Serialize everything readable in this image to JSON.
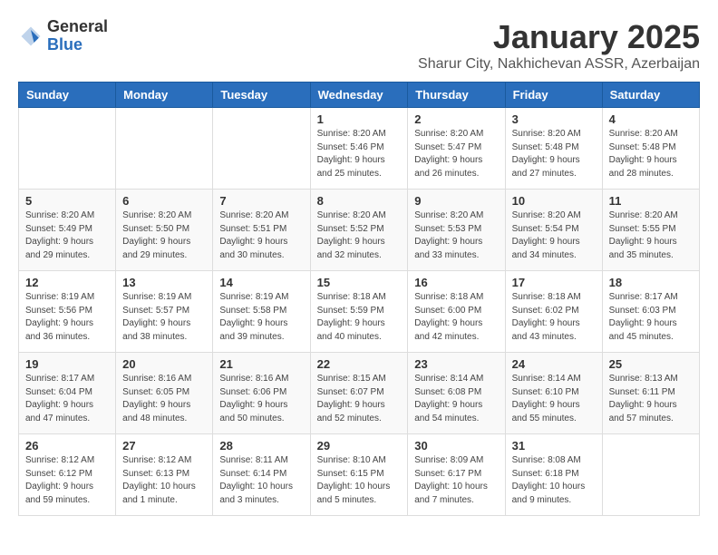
{
  "logo": {
    "general": "General",
    "blue": "Blue"
  },
  "title": "January 2025",
  "location": "Sharur City, Nakhichevan ASSR, Azerbaijan",
  "weekdays": [
    "Sunday",
    "Monday",
    "Tuesday",
    "Wednesday",
    "Thursday",
    "Friday",
    "Saturday"
  ],
  "weeks": [
    [
      {
        "day": "",
        "info": ""
      },
      {
        "day": "",
        "info": ""
      },
      {
        "day": "",
        "info": ""
      },
      {
        "day": "1",
        "info": "Sunrise: 8:20 AM\nSunset: 5:46 PM\nDaylight: 9 hours\nand 25 minutes."
      },
      {
        "day": "2",
        "info": "Sunrise: 8:20 AM\nSunset: 5:47 PM\nDaylight: 9 hours\nand 26 minutes."
      },
      {
        "day": "3",
        "info": "Sunrise: 8:20 AM\nSunset: 5:48 PM\nDaylight: 9 hours\nand 27 minutes."
      },
      {
        "day": "4",
        "info": "Sunrise: 8:20 AM\nSunset: 5:48 PM\nDaylight: 9 hours\nand 28 minutes."
      }
    ],
    [
      {
        "day": "5",
        "info": "Sunrise: 8:20 AM\nSunset: 5:49 PM\nDaylight: 9 hours\nand 29 minutes."
      },
      {
        "day": "6",
        "info": "Sunrise: 8:20 AM\nSunset: 5:50 PM\nDaylight: 9 hours\nand 29 minutes."
      },
      {
        "day": "7",
        "info": "Sunrise: 8:20 AM\nSunset: 5:51 PM\nDaylight: 9 hours\nand 30 minutes."
      },
      {
        "day": "8",
        "info": "Sunrise: 8:20 AM\nSunset: 5:52 PM\nDaylight: 9 hours\nand 32 minutes."
      },
      {
        "day": "9",
        "info": "Sunrise: 8:20 AM\nSunset: 5:53 PM\nDaylight: 9 hours\nand 33 minutes."
      },
      {
        "day": "10",
        "info": "Sunrise: 8:20 AM\nSunset: 5:54 PM\nDaylight: 9 hours\nand 34 minutes."
      },
      {
        "day": "11",
        "info": "Sunrise: 8:20 AM\nSunset: 5:55 PM\nDaylight: 9 hours\nand 35 minutes."
      }
    ],
    [
      {
        "day": "12",
        "info": "Sunrise: 8:19 AM\nSunset: 5:56 PM\nDaylight: 9 hours\nand 36 minutes."
      },
      {
        "day": "13",
        "info": "Sunrise: 8:19 AM\nSunset: 5:57 PM\nDaylight: 9 hours\nand 38 minutes."
      },
      {
        "day": "14",
        "info": "Sunrise: 8:19 AM\nSunset: 5:58 PM\nDaylight: 9 hours\nand 39 minutes."
      },
      {
        "day": "15",
        "info": "Sunrise: 8:18 AM\nSunset: 5:59 PM\nDaylight: 9 hours\nand 40 minutes."
      },
      {
        "day": "16",
        "info": "Sunrise: 8:18 AM\nSunset: 6:00 PM\nDaylight: 9 hours\nand 42 minutes."
      },
      {
        "day": "17",
        "info": "Sunrise: 8:18 AM\nSunset: 6:02 PM\nDaylight: 9 hours\nand 43 minutes."
      },
      {
        "day": "18",
        "info": "Sunrise: 8:17 AM\nSunset: 6:03 PM\nDaylight: 9 hours\nand 45 minutes."
      }
    ],
    [
      {
        "day": "19",
        "info": "Sunrise: 8:17 AM\nSunset: 6:04 PM\nDaylight: 9 hours\nand 47 minutes."
      },
      {
        "day": "20",
        "info": "Sunrise: 8:16 AM\nSunset: 6:05 PM\nDaylight: 9 hours\nand 48 minutes."
      },
      {
        "day": "21",
        "info": "Sunrise: 8:16 AM\nSunset: 6:06 PM\nDaylight: 9 hours\nand 50 minutes."
      },
      {
        "day": "22",
        "info": "Sunrise: 8:15 AM\nSunset: 6:07 PM\nDaylight: 9 hours\nand 52 minutes."
      },
      {
        "day": "23",
        "info": "Sunrise: 8:14 AM\nSunset: 6:08 PM\nDaylight: 9 hours\nand 54 minutes."
      },
      {
        "day": "24",
        "info": "Sunrise: 8:14 AM\nSunset: 6:10 PM\nDaylight: 9 hours\nand 55 minutes."
      },
      {
        "day": "25",
        "info": "Sunrise: 8:13 AM\nSunset: 6:11 PM\nDaylight: 9 hours\nand 57 minutes."
      }
    ],
    [
      {
        "day": "26",
        "info": "Sunrise: 8:12 AM\nSunset: 6:12 PM\nDaylight: 9 hours\nand 59 minutes."
      },
      {
        "day": "27",
        "info": "Sunrise: 8:12 AM\nSunset: 6:13 PM\nDaylight: 10 hours\nand 1 minute."
      },
      {
        "day": "28",
        "info": "Sunrise: 8:11 AM\nSunset: 6:14 PM\nDaylight: 10 hours\nand 3 minutes."
      },
      {
        "day": "29",
        "info": "Sunrise: 8:10 AM\nSunset: 6:15 PM\nDaylight: 10 hours\nand 5 minutes."
      },
      {
        "day": "30",
        "info": "Sunrise: 8:09 AM\nSunset: 6:17 PM\nDaylight: 10 hours\nand 7 minutes."
      },
      {
        "day": "31",
        "info": "Sunrise: 8:08 AM\nSunset: 6:18 PM\nDaylight: 10 hours\nand 9 minutes."
      },
      {
        "day": "",
        "info": ""
      }
    ]
  ]
}
